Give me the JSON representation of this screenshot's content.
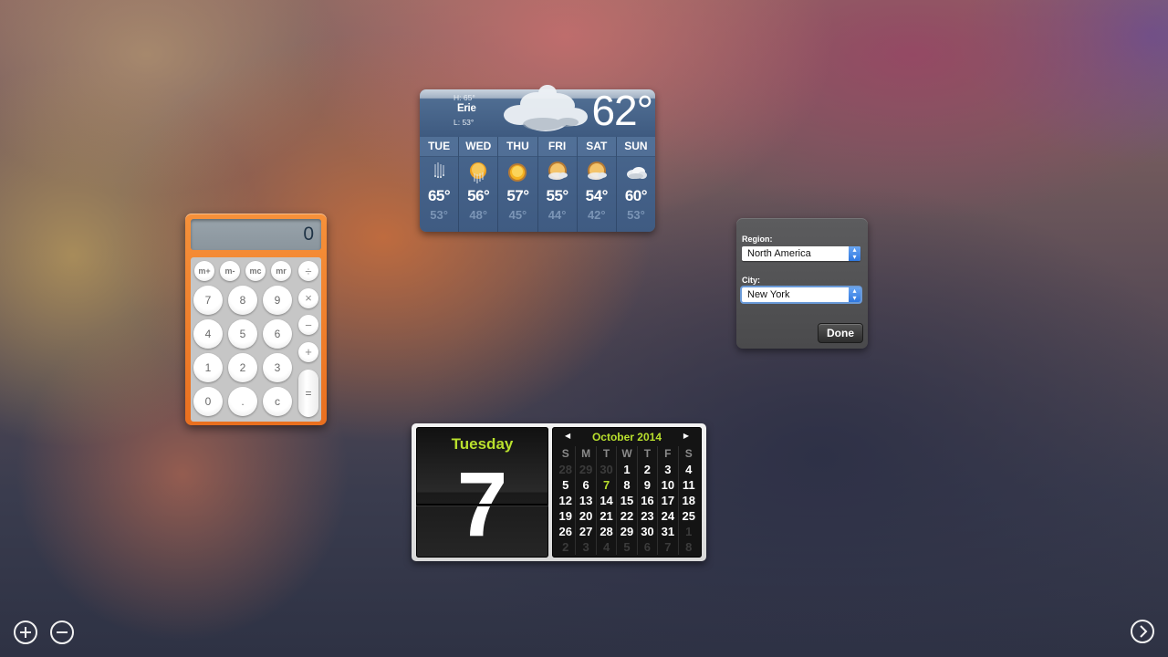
{
  "calculator": {
    "display": "0",
    "memory_keys": [
      "m+",
      "m-",
      "mc",
      "mr"
    ],
    "digit_rows": [
      [
        "7",
        "8",
        "9"
      ],
      [
        "4",
        "5",
        "6"
      ],
      [
        "1",
        "2",
        "3"
      ],
      [
        "0",
        ".",
        "c"
      ]
    ],
    "operators": [
      "÷",
      "×",
      "−",
      "+"
    ],
    "equals": "="
  },
  "weather": {
    "city": "Erie",
    "high": "H: 65°",
    "low": "L: 53°",
    "current_temp": "62°",
    "current_icon": "cloudy-icon",
    "forecast": [
      {
        "day": "TUE",
        "high": "65°",
        "low": "53°",
        "icon": "rain-icon"
      },
      {
        "day": "WED",
        "high": "56°",
        "low": "48°",
        "icon": "sun-rain-icon"
      },
      {
        "day": "THU",
        "high": "57°",
        "low": "45°",
        "icon": "sun-icon"
      },
      {
        "day": "FRI",
        "high": "55°",
        "low": "44°",
        "icon": "partly-cloudy-icon"
      },
      {
        "day": "SAT",
        "high": "54°",
        "low": "42°",
        "icon": "partly-cloudy-icon"
      },
      {
        "day": "SUN",
        "high": "60°",
        "low": "53°",
        "icon": "cloudy-icon"
      }
    ]
  },
  "weather_settings": {
    "region_label": "Region:",
    "region_value": "North America",
    "city_label": "City:",
    "city_value": "New York",
    "done_label": "Done",
    "accent": "#2f78e0"
  },
  "calendar": {
    "day_name": "Tuesday",
    "day_number": "7",
    "month_title": "October 2014",
    "weekday_headers": [
      "S",
      "M",
      "T",
      "W",
      "T",
      "F",
      "S"
    ],
    "weeks": [
      [
        {
          "d": "28",
          "dim": true
        },
        {
          "d": "29",
          "dim": true
        },
        {
          "d": "30",
          "dim": true
        },
        {
          "d": "1"
        },
        {
          "d": "2"
        },
        {
          "d": "3"
        },
        {
          "d": "4"
        }
      ],
      [
        {
          "d": "5"
        },
        {
          "d": "6"
        },
        {
          "d": "7",
          "today": true
        },
        {
          "d": "8"
        },
        {
          "d": "9"
        },
        {
          "d": "10"
        },
        {
          "d": "11"
        }
      ],
      [
        {
          "d": "12"
        },
        {
          "d": "13"
        },
        {
          "d": "14"
        },
        {
          "d": "15"
        },
        {
          "d": "16"
        },
        {
          "d": "17"
        },
        {
          "d": "18"
        }
      ],
      [
        {
          "d": "19"
        },
        {
          "d": "20"
        },
        {
          "d": "21"
        },
        {
          "d": "22"
        },
        {
          "d": "23"
        },
        {
          "d": "24"
        },
        {
          "d": "25"
        }
      ],
      [
        {
          "d": "26"
        },
        {
          "d": "27"
        },
        {
          "d": "28"
        },
        {
          "d": "29"
        },
        {
          "d": "30"
        },
        {
          "d": "31"
        },
        {
          "d": "1",
          "dim": true
        }
      ],
      [
        {
          "d": "2",
          "dim": true
        },
        {
          "d": "3",
          "dim": true
        },
        {
          "d": "4",
          "dim": true
        },
        {
          "d": "5",
          "dim": true
        },
        {
          "d": "6",
          "dim": true
        },
        {
          "d": "7",
          "dim": true
        },
        {
          "d": "8",
          "dim": true
        }
      ]
    ],
    "accent": "#b9e02d"
  },
  "dashboard": {
    "add_icon": "plus-circle-icon",
    "remove_icon": "minus-circle-icon",
    "next_icon": "chevron-right-circle-icon"
  }
}
